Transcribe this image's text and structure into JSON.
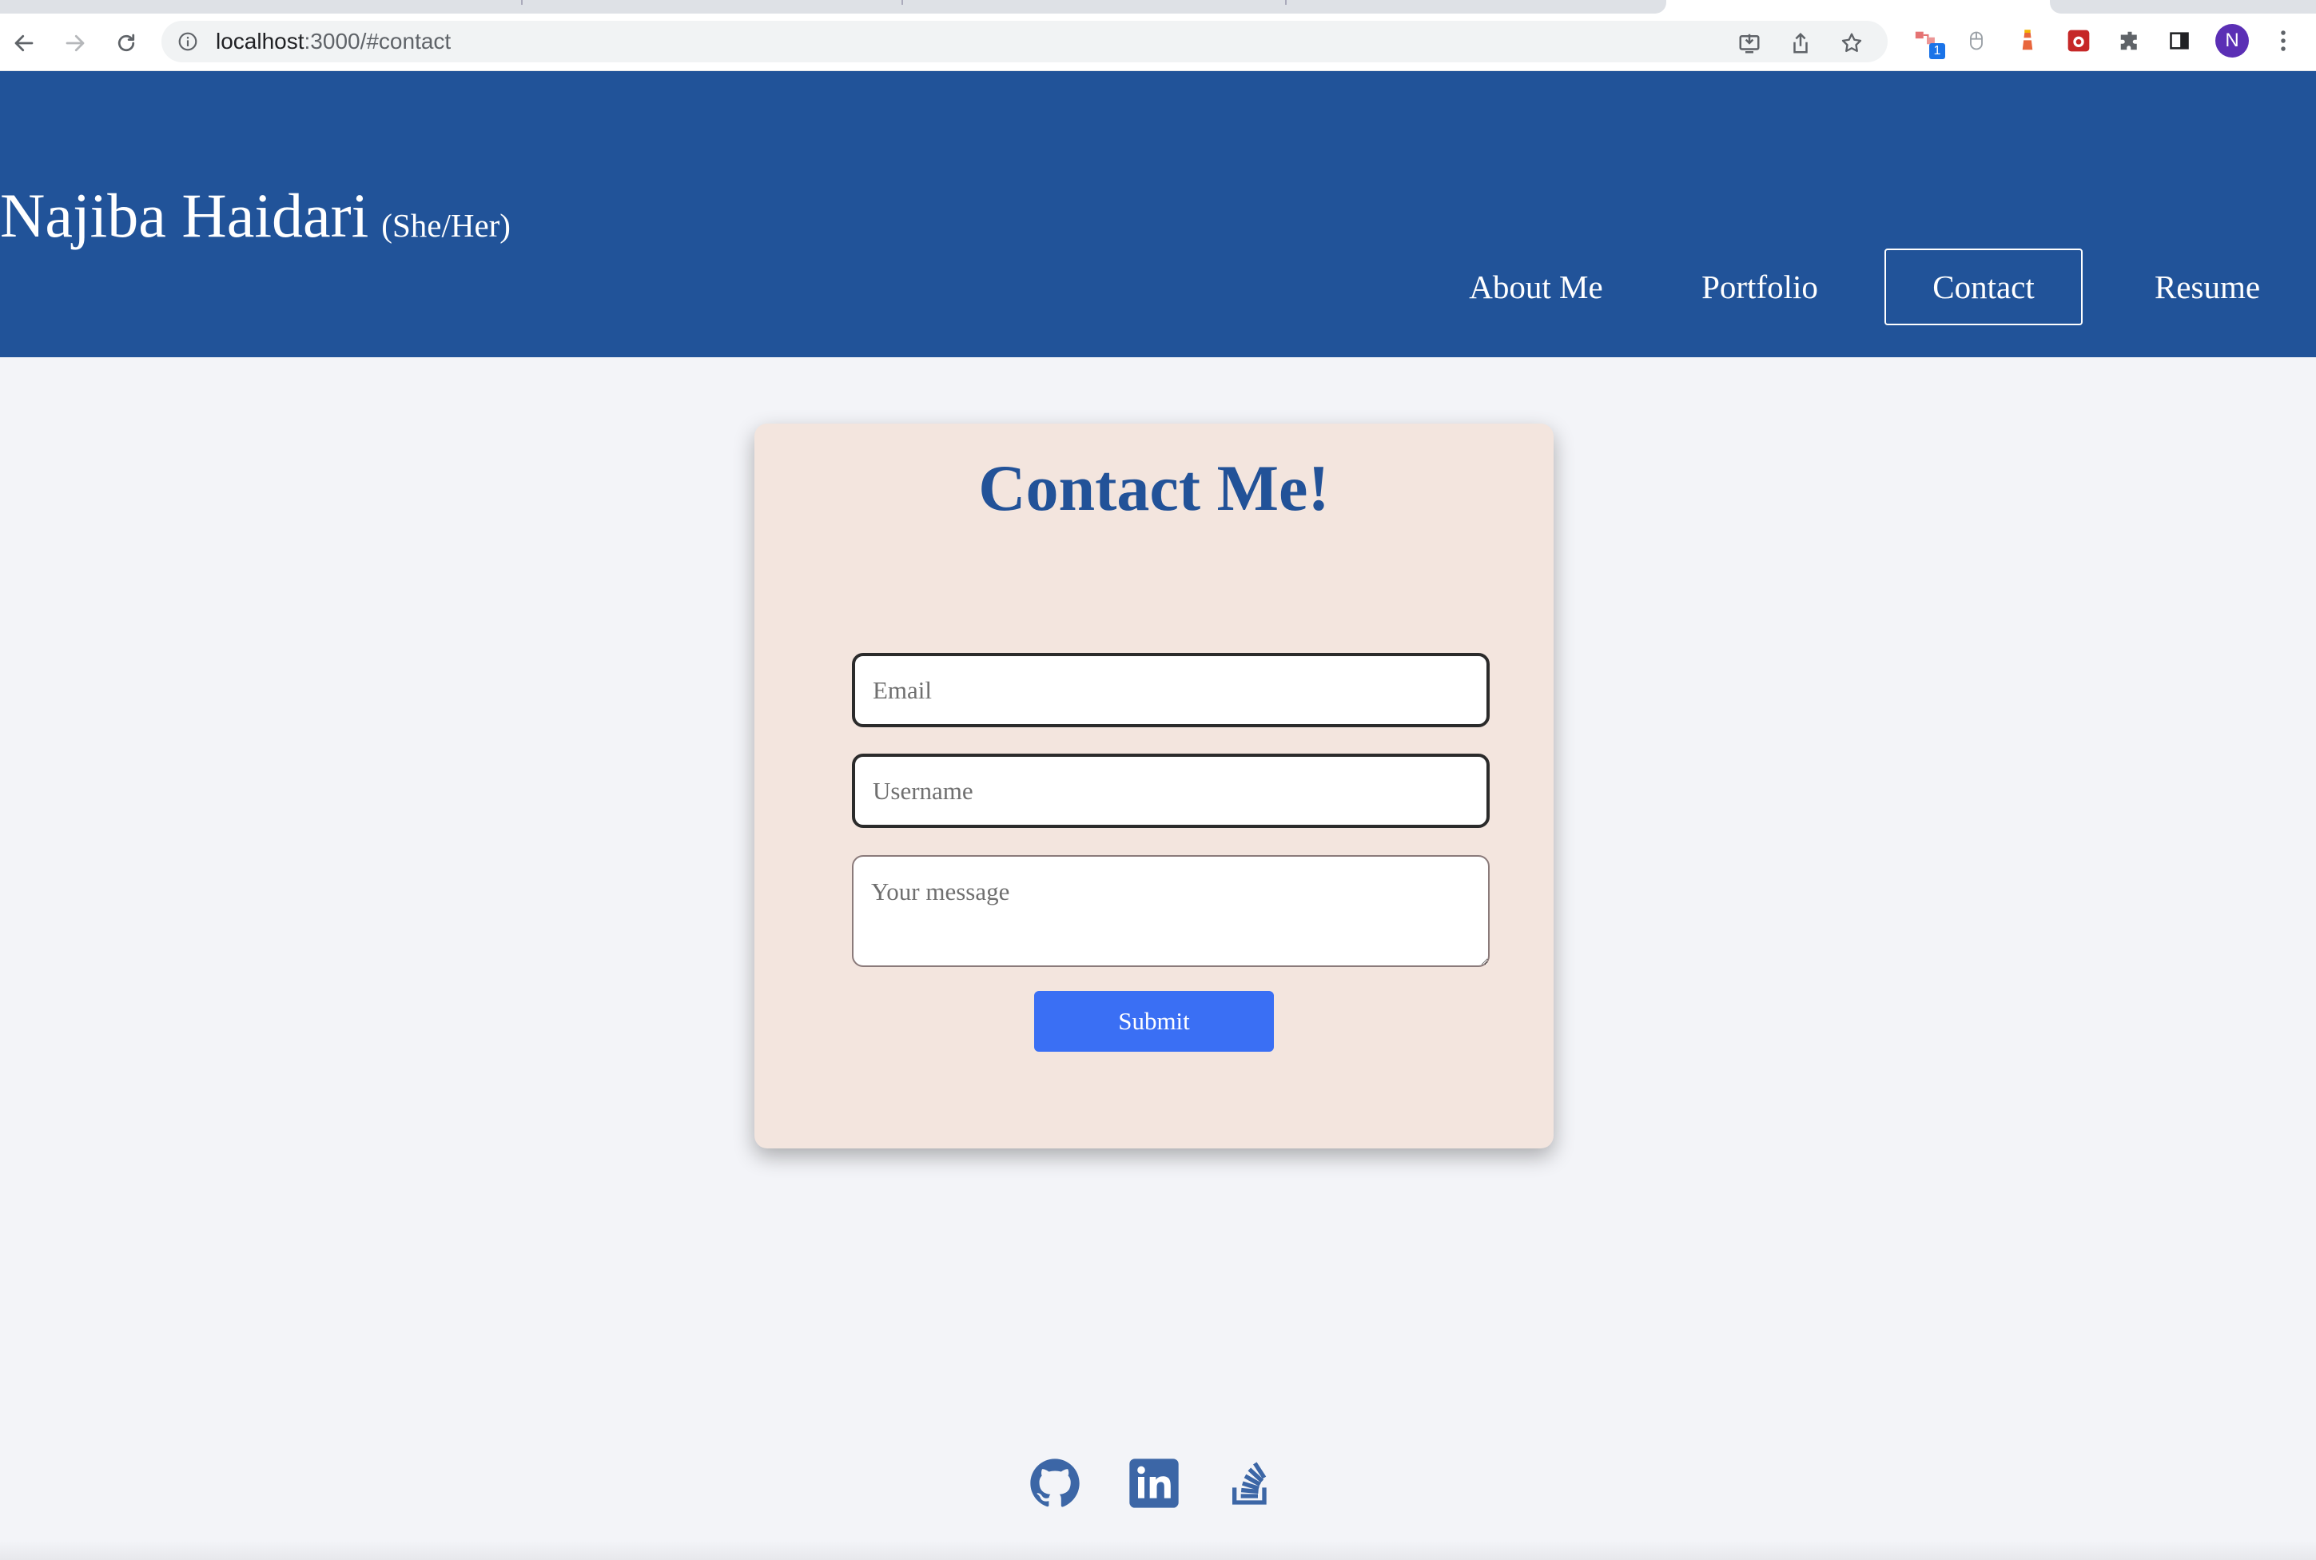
{
  "browser": {
    "url_host": "localhost",
    "url_rest": ":3000/#contact",
    "profile_initial": "N",
    "extension_badge": "1"
  },
  "header": {
    "name": "Najiba Haidari",
    "pronouns": "(She/Her)",
    "nav": [
      {
        "label": "About Me",
        "active": false
      },
      {
        "label": "Portfolio",
        "active": false
      },
      {
        "label": "Contact",
        "active": true
      },
      {
        "label": "Resume",
        "active": false
      }
    ]
  },
  "contact": {
    "title": "Contact Me!",
    "email_placeholder": "Email",
    "username_placeholder": "Username",
    "message_placeholder": "Your message",
    "submit_label": "Submit"
  },
  "footer": {
    "social": [
      "github-icon",
      "linkedin-icon",
      "stackoverflow-icon"
    ]
  },
  "colors": {
    "header_bg": "#215399",
    "card_bg": "#f3e5de",
    "title": "#225298",
    "submit_bg": "#3a6ff4",
    "icon": "#3c66a6"
  }
}
